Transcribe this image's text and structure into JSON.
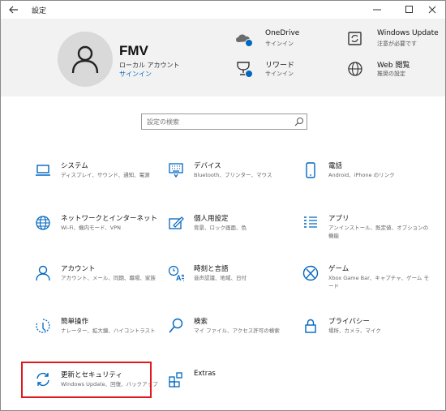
{
  "window": {
    "title": "設定",
    "back_icon": "arrow-left-icon",
    "controls": [
      "minimize-icon",
      "maximize-icon",
      "close-icon"
    ]
  },
  "account": {
    "name": "FMV",
    "type": "ローカル アカウント",
    "signin_label": "サインイン"
  },
  "header_items": [
    {
      "title": "OneDrive",
      "subtitle": "サインイン",
      "icon": "onedrive-cloud-icon"
    },
    {
      "title": "Windows Update",
      "subtitle": "注意が必要です",
      "icon": "windows-update-icon"
    },
    {
      "title": "リワード",
      "subtitle": "サインイン",
      "icon": "rewards-trophy-icon"
    },
    {
      "title": "Web 閲覧",
      "subtitle": "推奨の設定",
      "icon": "globe-icon"
    }
  ],
  "search": {
    "placeholder": "設定の検索",
    "icon": "search-icon"
  },
  "tiles": [
    {
      "title": "システム",
      "desc": "ディスプレイ、サウンド、通知、電源",
      "icon": "laptop-icon"
    },
    {
      "title": "デバイス",
      "desc": "Bluetooth、プリンター、マウス",
      "icon": "keyboard-icon"
    },
    {
      "title": "電話",
      "desc": "Android、iPhone のリンク",
      "icon": "phone-icon"
    },
    {
      "title": "ネットワークとインターネット",
      "desc": "Wi-Fi、機内モード、VPN",
      "icon": "network-globe-icon"
    },
    {
      "title": "個人用設定",
      "desc": "背景、ロック画面、色",
      "icon": "personalization-icon"
    },
    {
      "title": "アプリ",
      "desc": "アンインストール、既定値、オプションの機能",
      "icon": "apps-list-icon"
    },
    {
      "title": "アカウント",
      "desc": "アカウント、メール、同期、職場、家族",
      "icon": "person-icon"
    },
    {
      "title": "時刻と言語",
      "desc": "音声認識、地域、日付",
      "icon": "time-language-icon"
    },
    {
      "title": "ゲーム",
      "desc": "Xbox Game Bar、キャプチャ、ゲーム モード",
      "icon": "xbox-icon"
    },
    {
      "title": "簡単操作",
      "desc": "ナレーター、拡大鏡、ハイコントラスト",
      "icon": "ease-of-access-icon"
    },
    {
      "title": "検索",
      "desc": "マイ ファイル、アクセス許可の検索",
      "icon": "search-magnifier-icon"
    },
    {
      "title": "プライバシー",
      "desc": "場所、カメラ、マイク",
      "icon": "privacy-lock-icon"
    },
    {
      "title": "更新とセキュリティ",
      "desc": "Windows Update、回復、バックアップ",
      "icon": "update-sync-icon"
    },
    {
      "title": "Extras",
      "desc": "",
      "icon": "extras-icon"
    }
  ],
  "colors": {
    "accent": "#0067c0",
    "header_bg": "#f2f2f2",
    "highlight": "#e0191f"
  }
}
